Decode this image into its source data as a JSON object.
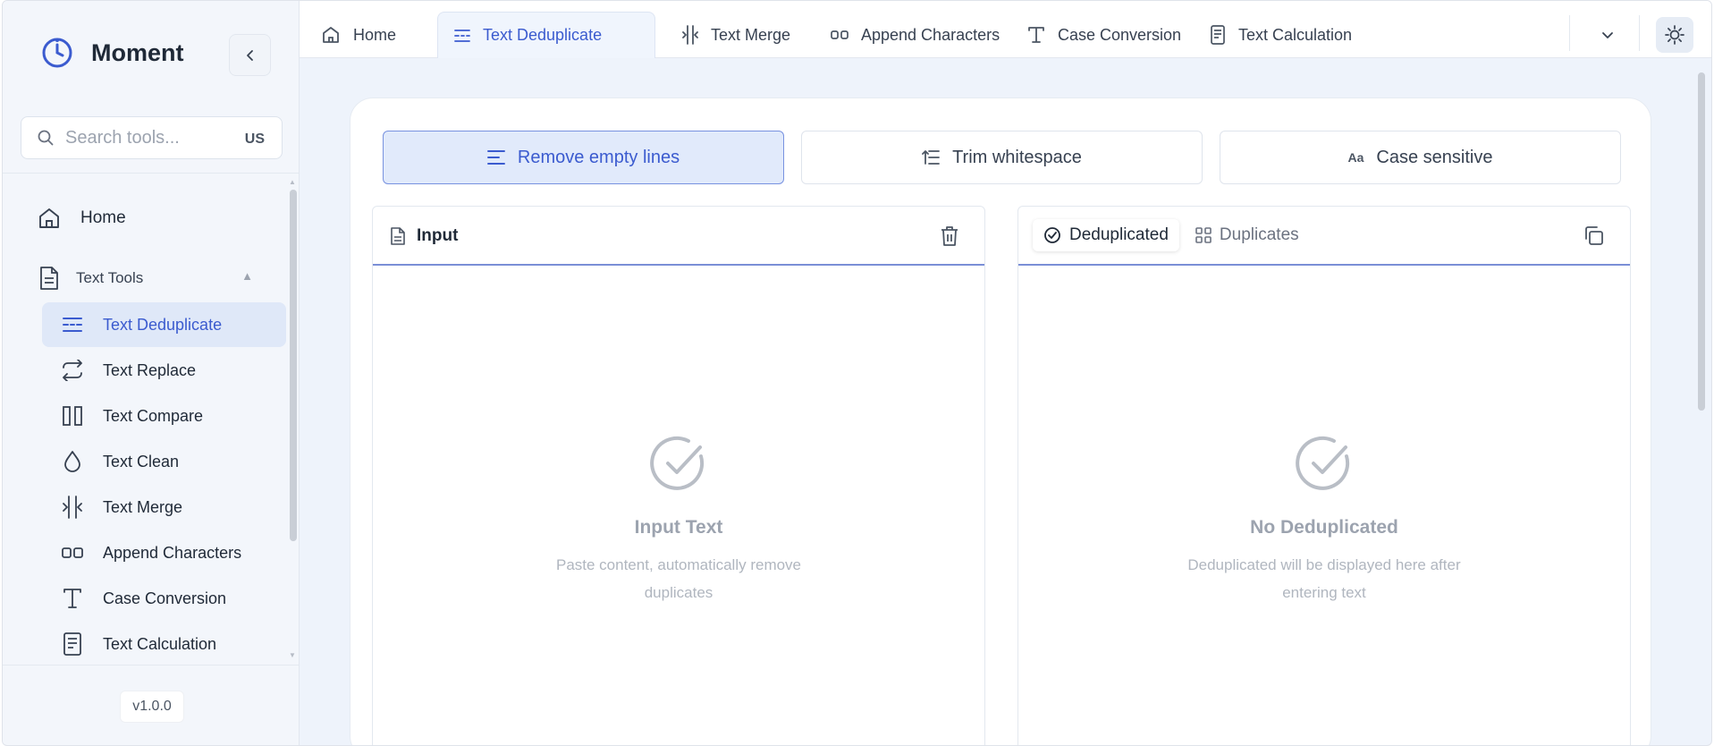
{
  "brand": {
    "name": "Moment"
  },
  "search": {
    "placeholder": "Search tools...",
    "shortcut": "US"
  },
  "sidebar": {
    "home_label": "Home",
    "group_label": "Text Tools",
    "items": [
      {
        "label": "Text Deduplicate",
        "icon": "deduplicate-icon",
        "active": true
      },
      {
        "label": "Text Replace",
        "icon": "replace-icon"
      },
      {
        "label": "Text Compare",
        "icon": "compare-icon"
      },
      {
        "label": "Text Clean",
        "icon": "droplet-icon"
      },
      {
        "label": "Text Merge",
        "icon": "merge-icon"
      },
      {
        "label": "Append Characters",
        "icon": "append-icon"
      },
      {
        "label": "Case Conversion",
        "icon": "text-t-icon"
      },
      {
        "label": "Text Calculation",
        "icon": "calculation-icon"
      }
    ],
    "version": "v1.0.0"
  },
  "tabs": [
    {
      "label": "Home",
      "icon": "home-icon"
    },
    {
      "label": "Text Deduplicate",
      "icon": "deduplicate-icon",
      "active": true
    },
    {
      "label": "Text Merge",
      "icon": "merge-icon"
    },
    {
      "label": "Append Characters",
      "icon": "append-icon"
    },
    {
      "label": "Case Conversion",
      "icon": "text-t-icon"
    },
    {
      "label": "Text Calculation",
      "icon": "calculation-icon"
    }
  ],
  "options": {
    "remove_empty": "Remove empty lines",
    "trim": "Trim whitespace",
    "case_icon_text": "Aa",
    "case": "Case sensitive"
  },
  "input_panel": {
    "title": "Input",
    "empty_title": "Input Text",
    "empty_desc": "Paste content, automatically remove duplicates"
  },
  "output_panel": {
    "tab_deduplicated": "Deduplicated",
    "tab_duplicates": "Duplicates",
    "empty_title": "No Deduplicated",
    "empty_desc": "Deduplicated will be displayed here after entering text"
  },
  "colors": {
    "accent": "#3b5bcf",
    "accent_bg": "#e1eafb",
    "sidebar_bg": "#f3f6fb",
    "main_bg": "#eef3fb"
  }
}
